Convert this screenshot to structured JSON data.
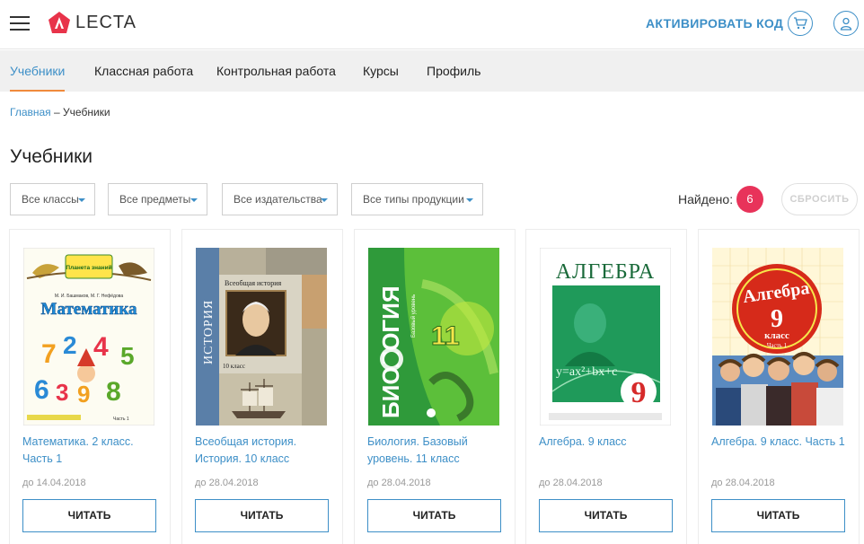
{
  "header": {
    "logo_text": "LECTA",
    "activate_label": "АКТИВИРОВАТЬ КОД"
  },
  "nav": {
    "items": [
      {
        "label": "Учебники",
        "active": true
      },
      {
        "label": "Классная работа",
        "active": false
      },
      {
        "label": "Контрольная работа",
        "active": false
      },
      {
        "label": "Курсы",
        "active": false
      },
      {
        "label": "Профиль",
        "active": false
      }
    ]
  },
  "breadcrumb": {
    "home": "Главная",
    "separator": " – ",
    "current": "Учебники"
  },
  "page_title": "Учебники",
  "filters": {
    "grades": "Все классы",
    "subjects": "Все предметы",
    "publishers": "Все издательства",
    "product_types": "Все типы продукции"
  },
  "results": {
    "found_label": "Найдено:",
    "count": "6",
    "reset_label": "СБРОСИТЬ"
  },
  "books": [
    {
      "title": "Математика. 2 класс. Часть 1",
      "date": "до 14.04.2018",
      "read_label": "ЧИТАТЬ",
      "cover": {
        "top": "Планета знаний",
        "authors": "М. И. Башмаков, М. Г. Нефёдова",
        "subject": "Математика",
        "bottom": "Часть 1"
      }
    },
    {
      "title": "Всеобщая история. История. 10 класс",
      "date": "до 28.04.2018",
      "read_label": "ЧИТАТЬ",
      "cover": {
        "spine": "ИСТОРИЯ",
        "subject": "Всеобщая история",
        "grade": "10 класс"
      }
    },
    {
      "title": "Биология. Базовый уровень. 11 класс",
      "date": "до 28.04.2018",
      "read_label": "ЧИТАТЬ",
      "cover": {
        "spine": "БИОЛОГИЯ",
        "level": "Базовый уровень",
        "grade": "11"
      }
    },
    {
      "title": "Алгебра. 9 класс",
      "date": "до 28.04.2018",
      "read_label": "ЧИТАТЬ",
      "cover": {
        "subject": "АЛГЕБРА",
        "formula": "y=ax²+bx+c",
        "grade": "9"
      }
    },
    {
      "title": "Алгебра. 9 класс. Часть 1",
      "date": "до 28.04.2018",
      "read_label": "ЧИТАТЬ",
      "cover": {
        "subject": "Алгебра",
        "grade": "9",
        "grade_word": "класс",
        "part": "Часть 1"
      }
    }
  ],
  "colors": {
    "accent": "#3d8fc7",
    "nav_underline": "#f08a3c",
    "badge": "#e8335a",
    "logo": "#e8334a"
  }
}
